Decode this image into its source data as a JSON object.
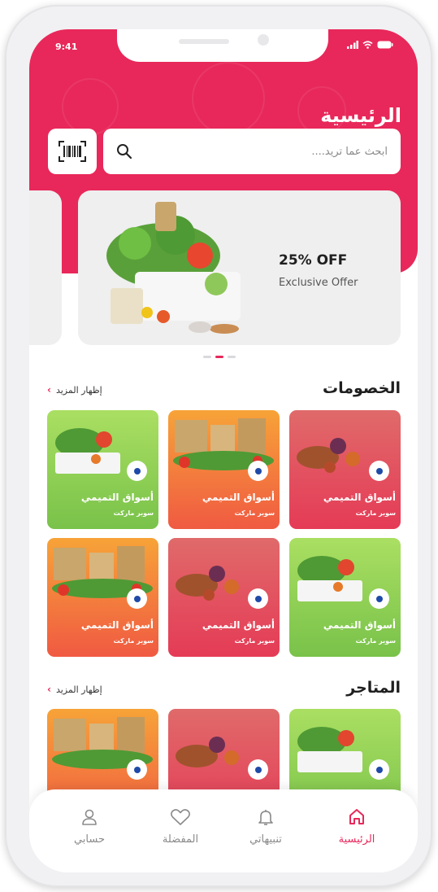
{
  "status_bar": {
    "time": "9:41"
  },
  "header": {
    "title": "الرئيسية"
  },
  "search": {
    "placeholder": "ابحث عما تريد...."
  },
  "banner": {
    "discount": "25% OFF",
    "subtitle": "Exclusive Offer"
  },
  "sections": [
    {
      "title": "الخصومات",
      "more_label": "إظهار المزيد",
      "cards": [
        {
          "name": "أسواق التميمي",
          "type": "سوبر ماركت"
        },
        {
          "name": "أسواق التميمي",
          "type": "سوبر ماركت"
        },
        {
          "name": "أسواق التميمي",
          "type": "سوبر ماركت"
        },
        {
          "name": "أسواق التميمي",
          "type": "سوبر ماركت"
        },
        {
          "name": "أسواق التميمي",
          "type": "سوبر ماركت"
        },
        {
          "name": "أسواق التميمي",
          "type": "سوبر ماركت"
        }
      ]
    },
    {
      "title": "المتاجر",
      "more_label": "إظهار المزيد"
    }
  ],
  "bottom_nav": [
    {
      "label": "الرئيسية",
      "icon": "home-icon",
      "active": true
    },
    {
      "label": "تنبيهاتي",
      "icon": "bell-icon",
      "active": false
    },
    {
      "label": "المفضلة",
      "icon": "heart-icon",
      "active": false
    },
    {
      "label": "حسابي",
      "icon": "user-icon",
      "active": false
    }
  ],
  "colors": {
    "accent": "#e8285a",
    "green": "#8fd152",
    "orange": "#f47e3c",
    "red": "#e44d5c"
  }
}
